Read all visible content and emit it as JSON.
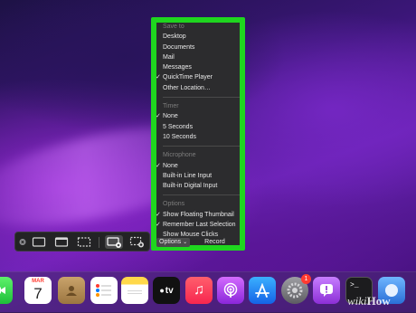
{
  "menu": {
    "save_to_header": "Save to",
    "save_to_items": [
      "Desktop",
      "Documents",
      "Mail",
      "Messages",
      "QuickTime Player",
      "Other Location…"
    ],
    "timer_header": "Timer",
    "timer_items": [
      "None",
      "5 Seconds",
      "10 Seconds"
    ],
    "microphone_header": "Microphone",
    "microphone_items": [
      "None",
      "Built-in Line Input",
      "Built-in Digital Input"
    ],
    "options_header": "Options",
    "options_items": [
      "Show Floating Thumbnail",
      "Remember Last Selection",
      "Show Mouse Clicks"
    ],
    "checkmark": "✓"
  },
  "bottom_bar": {
    "options_label": "Options",
    "options_chevron": "⌄",
    "record_label": "Record"
  },
  "toolbar": {
    "buttons": [
      "close-icon",
      "capture-screen-icon",
      "capture-window-icon",
      "capture-selection-icon",
      "record-screen-icon",
      "record-selection-icon"
    ]
  },
  "dock": {
    "calendar_month": "MAR",
    "calendar_day": "7",
    "tv_label": "tv",
    "settings_badge": "1",
    "terminal_prompt": ">_"
  },
  "watermark": {
    "wiki": "wiki",
    "how": "How"
  },
  "colors": {
    "highlight_outline": "#1fd61f",
    "menu_bg": "#2c2c2e"
  }
}
